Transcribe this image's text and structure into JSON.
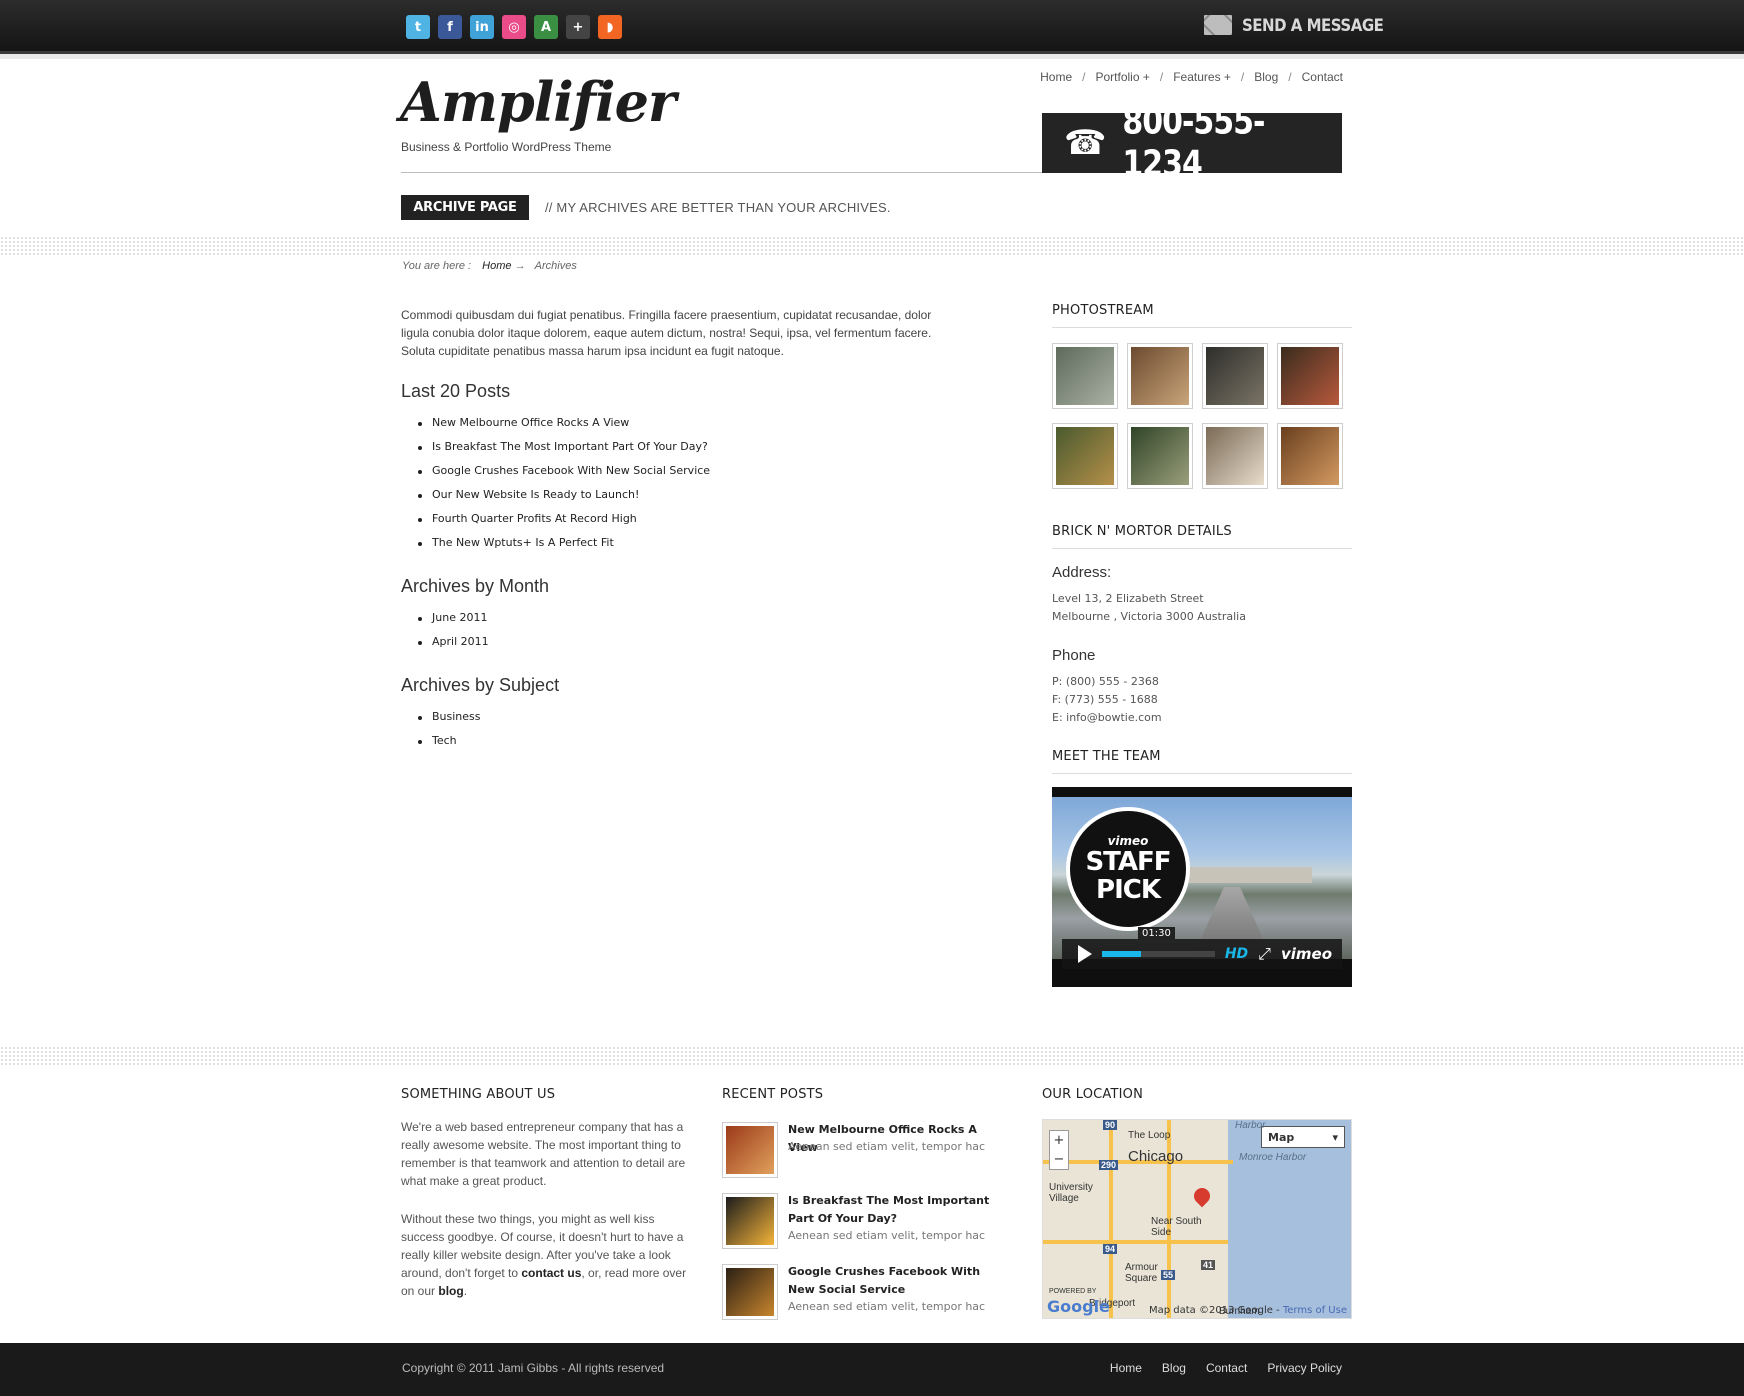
{
  "topbar": {
    "social": [
      {
        "icon": "twitter-icon",
        "glyph": "t",
        "color": "#4fb3e4"
      },
      {
        "icon": "facebook-icon",
        "glyph": "f",
        "color": "#3b5998"
      },
      {
        "icon": "linkedin-icon",
        "glyph": "in",
        "color": "#3fa3d8"
      },
      {
        "icon": "dribbble-icon",
        "glyph": "◎",
        "color": "#ea4c89"
      },
      {
        "icon": "forrst-icon",
        "glyph": "A",
        "color": "#3a8f43"
      },
      {
        "icon": "delicious-icon",
        "glyph": "+",
        "color": "#444444"
      },
      {
        "icon": "rss-icon",
        "glyph": "◗",
        "color": "#f26522"
      }
    ],
    "send_message": "SEND A MESSAGE"
  },
  "header": {
    "logo": "Amplifier",
    "tagline": "Business & Portfolio WordPress Theme",
    "nav": [
      "Home",
      "Portfolio +",
      "Features +",
      "Blog",
      "Contact"
    ],
    "phone": "800-555-1234",
    "archive_badge": "ARCHIVE PAGE",
    "archive_subtitle": "// MY ARCHIVES ARE BETTER THAN YOUR ARCHIVES."
  },
  "breadcrumb": {
    "prefix": "You are here :",
    "home": "Home",
    "arrow": "→",
    "current": "Archives"
  },
  "main": {
    "intro": "Commodi quibusdam dui fugiat penatibus. Fringilla facere praesentium, cupidatat recusandae, dolor ligula conubia dolor itaque dolorem, eaque autem dictum, nostra! Sequi, ipsa, vel fermentum facere. Soluta cupiditate penatibus massa harum ipsa incidunt ea fugit natoque.",
    "last_posts_title": "Last 20 Posts",
    "last_posts": [
      "New Melbourne Office Rocks A View",
      "Is Breakfast The Most Important Part Of Your Day?",
      "Google Crushes Facebook With New Social Service",
      "Our New Website Is Ready to Launch!",
      "Fourth Quarter Profits At Record High",
      "The New Wptuts+ Is A Perfect Fit"
    ],
    "by_month_title": "Archives by Month",
    "by_month": [
      "June 2011",
      "April 2011"
    ],
    "by_subject_title": "Archives by Subject",
    "by_subject": [
      "Business",
      "Tech"
    ]
  },
  "sidebar": {
    "photostream_title": "PHOTOSTREAM",
    "photos": [
      {
        "colors": [
          "#5e6a5c",
          "#a9b1a4"
        ]
      },
      {
        "colors": [
          "#6d4a2f",
          "#c9a57a"
        ]
      },
      {
        "colors": [
          "#2e2e2a",
          "#7a7466"
        ]
      },
      {
        "colors": [
          "#3a2c1e",
          "#b8593c"
        ]
      },
      {
        "colors": [
          "#4a5a2e",
          "#b5904a"
        ]
      },
      {
        "colors": [
          "#2f4427",
          "#9b9f7c"
        ]
      },
      {
        "colors": [
          "#7a6a56",
          "#e8dccb"
        ]
      },
      {
        "colors": [
          "#6a3f1e",
          "#d39a62"
        ]
      }
    ],
    "details_title": "BRICK N' MORTOR DETAILS",
    "address_label": "Address:",
    "address_line1": "Level 13, 2 Elizabeth Street",
    "address_line2": "Melbourne , Victoria 3000 Australia",
    "phone_label": "Phone",
    "phone_p": "P: (800) 555 - 2368",
    "phone_f": "F: (773) 555 - 1688",
    "phone_e": "E: info@bowtie.com",
    "team_title": "MEET THE TEAM",
    "video": {
      "badge_top": "vimeo",
      "badge_line1": "STAFF",
      "badge_line2": "PICK",
      "time": "01:30",
      "hd": "HD",
      "brand": "vimeo",
      "progress": 0.35
    }
  },
  "footer": {
    "about_title": "SOMETHING ABOUT US",
    "about_p1": "We're a web based entrepreneur company that has a really awesome website. The most important thing to remember is that teamwork and attention to detail are what make a great product.",
    "about_p2_a": "Without these two things, you might as well kiss success goodbye. Of course, it doesn't hurt to have a really killer website design. After you've take a look around, don't forget to ",
    "about_link1": "contact us",
    "about_p2_b": ", or, read more over on our ",
    "about_link2": "blog",
    "about_p2_c": ".",
    "recent_title": "RECENT POSTS",
    "recent": [
      {
        "title": "New Melbourne Office Rocks A View",
        "excerpt": "Aenean sed etiam velit, tempor hac",
        "colors": [
          "#9c3a1a",
          "#e0a15c"
        ]
      },
      {
        "title": "Is Breakfast The Most Important Part Of Your Day?",
        "excerpt": "Aenean sed etiam velit, tempor hac",
        "colors": [
          "#1c1c1c",
          "#f4b43a"
        ]
      },
      {
        "title": "Google Crushes Facebook With New Social Service",
        "excerpt": "Aenean sed etiam velit, tempor hac",
        "colors": [
          "#2b1f14",
          "#c8862e"
        ]
      }
    ],
    "location_title": "OUR LOCATION",
    "map": {
      "type_select": "Map",
      "labels": [
        "The Loop",
        "Chicago",
        "Monroe Harbor",
        "Harbor",
        "University Village",
        "Near South Side",
        "Armour Square",
        "Bridgeport",
        "Burnham"
      ],
      "road_shields": [
        "90",
        "290",
        "94",
        "55",
        "41"
      ],
      "data": "Map data ©2013 Google -",
      "terms": "Terms of Use",
      "google": "Google",
      "powered": "POWERED BY"
    },
    "copyright": "Copyright © 2011 Jami Gibbs - All rights reserved",
    "nav": [
      "Home",
      "Blog",
      "Contact",
      "Privacy Policy"
    ]
  }
}
